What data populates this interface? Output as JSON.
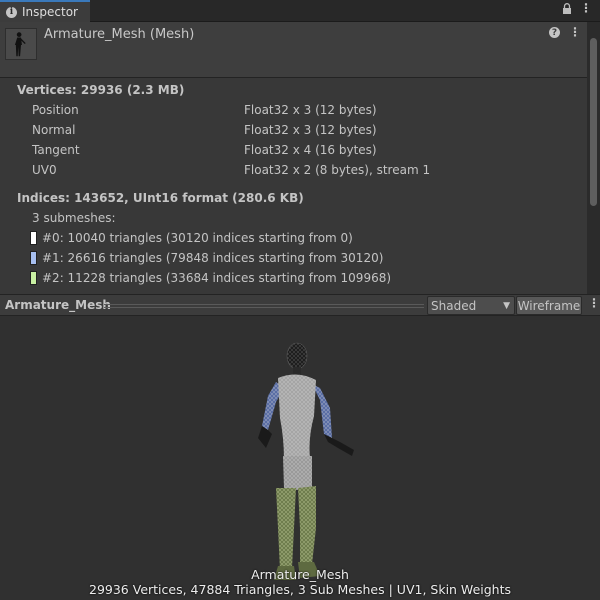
{
  "tab": {
    "label": "Inspector",
    "icon": "info-icon"
  },
  "header": {
    "title": "Armature_Mesh (Mesh)",
    "help": "?"
  },
  "vertices": {
    "title": "Vertices: 29936 (2.3 MB)",
    "rows": [
      {
        "label": "Position",
        "value": "Float32 x 3 (12 bytes)"
      },
      {
        "label": "Normal",
        "value": "Float32 x 3 (12 bytes)"
      },
      {
        "label": "Tangent",
        "value": "Float32 x 4 (16 bytes)"
      },
      {
        "label": "UV0",
        "value": "Float32 x 2 (8 bytes), stream 1"
      }
    ]
  },
  "indices": {
    "title": "Indices: 143652, UInt16 format (280.6 KB)",
    "submesh_count": "3 submeshes:",
    "submeshes": [
      {
        "text": "#0: 10040 triangles (30120 indices starting from 0)",
        "color": "#ffffff"
      },
      {
        "text": "#1: 26616 triangles (79848 indices starting from 30120)",
        "color": "#a7bff0"
      },
      {
        "text": "#2: 11228 triangles (33684 indices starting from 109968)",
        "color": "#c8f0a2"
      }
    ]
  },
  "preview": {
    "name": "Armature_Mesh",
    "shading": "Shaded",
    "wireframe_label": "Wireframe",
    "caption_name": "Armature_Mesh",
    "caption_stats": "29936 Vertices, 47884 Triangles, 3 Sub Meshes | UV1, Skin Weights"
  },
  "colors": {
    "accent": "#3a79bb",
    "submesh_body": "#a5a5a5",
    "submesh_arms": "#5a6ea5",
    "submesh_legs": "#6f7d4e"
  }
}
